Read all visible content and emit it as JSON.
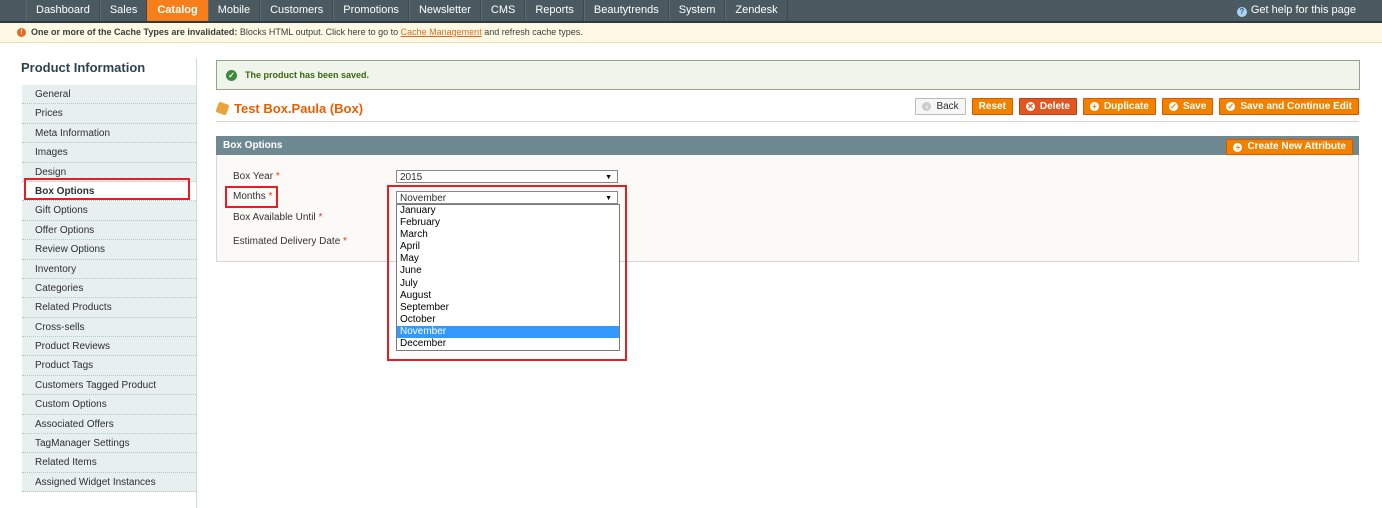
{
  "nav": {
    "items": [
      "Dashboard",
      "Sales",
      "Catalog",
      "Mobile",
      "Customers",
      "Promotions",
      "Newsletter",
      "CMS",
      "Reports",
      "Beautytrends",
      "System",
      "Zendesk"
    ],
    "active": "Catalog",
    "help": "Get help for this page"
  },
  "notice": {
    "bold": "One or more of the Cache Types are invalidated:",
    "text1": " Blocks HTML output. Click here to go to ",
    "link": "Cache Management",
    "text2": " and refresh cache types."
  },
  "sidebar": {
    "title": "Product Information",
    "items": [
      "General",
      "Prices",
      "Meta Information",
      "Images",
      "Design",
      "Box Options",
      "Gift Options",
      "Offer Options",
      "Review Options",
      "Inventory",
      "Categories",
      "Related Products",
      "Cross-sells",
      "Product Reviews",
      "Product Tags",
      "Customers Tagged Product",
      "Custom Options",
      "Associated Offers",
      "TagManager Settings",
      "Related Items",
      "Assigned Widget Instances"
    ],
    "active": "Box Options"
  },
  "success": {
    "text": "The product has been saved."
  },
  "product": {
    "title": "Test Box.Paula (Box)"
  },
  "buttons": {
    "back": "Back",
    "reset": "Reset",
    "delete": "Delete",
    "duplicate": "Duplicate",
    "save": "Save",
    "save_continue": "Save and Continue Edit"
  },
  "section": {
    "title": "Box Options",
    "create_attribute": "Create New Attribute"
  },
  "form": {
    "box_year_label": "Box Year",
    "box_year_value": "2015",
    "months_label": "Months",
    "months_value": "November",
    "available_until_label": "Box Available Until",
    "delivery_label": "Estimated Delivery Date",
    "required_mark": "*"
  },
  "months_options": [
    "January",
    "February",
    "March",
    "April",
    "May",
    "June",
    "July",
    "August",
    "September",
    "October",
    "November",
    "December"
  ],
  "months_selected": "November",
  "colors": {
    "accent": "#f18200",
    "nav_bg": "#4a5a60",
    "highlight": "#e81c23",
    "selection": "#3399ff"
  }
}
